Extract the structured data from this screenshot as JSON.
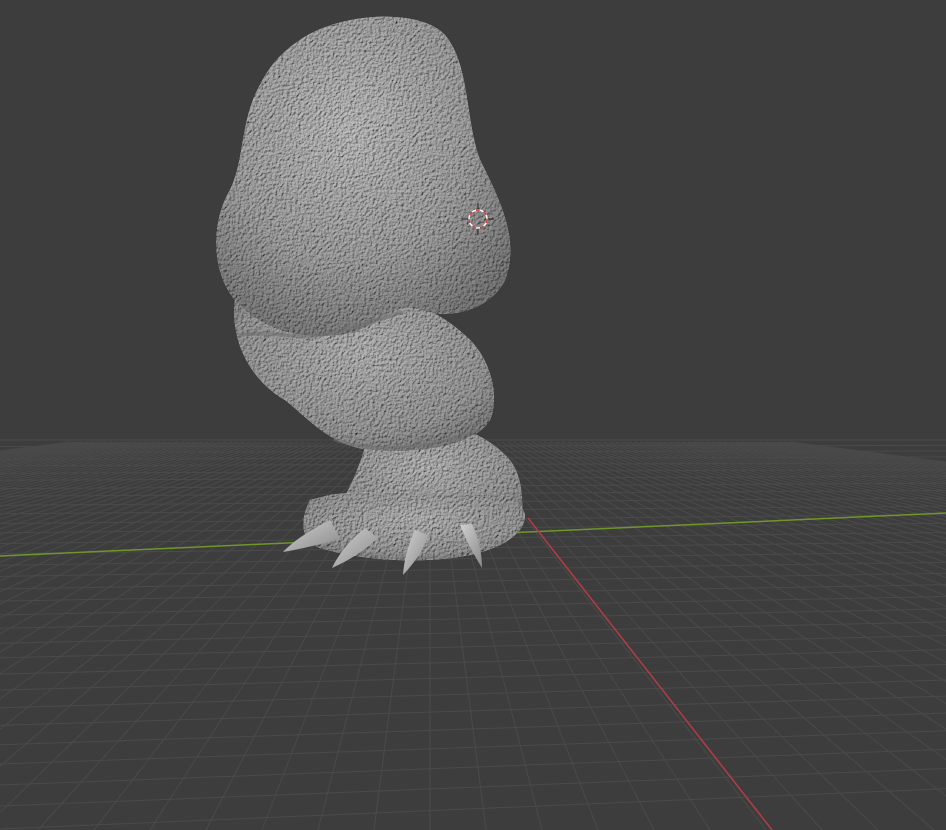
{
  "viewport": {
    "mode": "3d-viewport",
    "background": "#3d3d3d",
    "grid_color": "#4a4a4a",
    "x_axis_color": "#b43c46",
    "y_axis_color": "#6e9628",
    "mesh_color": "#a8a8a8",
    "mesh_highlight": "#c4c4c4",
    "mesh_shadow": "#7e7e7e",
    "cursor_color": "#d23c3c"
  },
  "scene": {
    "object": "sculpted-creature-mesh",
    "cursor": "3d-cursor-icon"
  }
}
